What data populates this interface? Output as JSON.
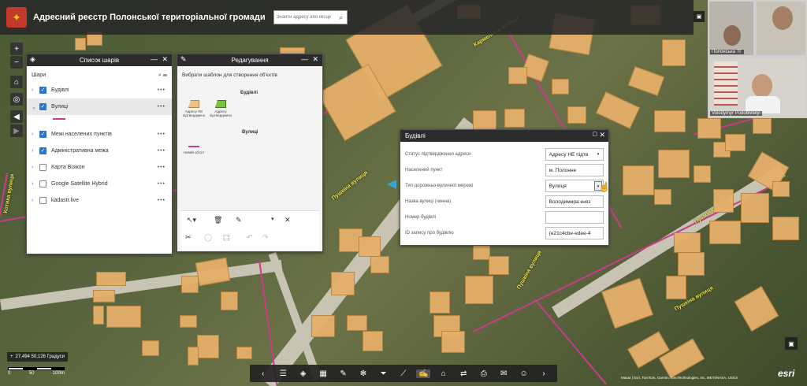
{
  "header": {
    "title": "Адресний реєстр Полонської територіальної громади",
    "search_placeholder": "Знайти адресу або місце",
    "search_icon": "search-icon"
  },
  "layer_list": {
    "title": "Список шарів",
    "section": "Шари",
    "items": [
      {
        "label": "Будівлі",
        "checked": true,
        "expanded": false
      },
      {
        "label": "Вулиці",
        "checked": true,
        "expanded": true
      },
      {
        "label": "Межі населених пунктів",
        "checked": true,
        "expanded": false
      },
      {
        "label": "Адміністративна межа",
        "checked": true,
        "expanded": false
      },
      {
        "label": "Карта Візікон",
        "checked": false,
        "expanded": false
      },
      {
        "label": "Google Satellite Hybrid",
        "checked": false,
        "expanded": false
      },
      {
        "label": "kadastr.live",
        "checked": false,
        "expanded": false
      }
    ]
  },
  "editor": {
    "title": "Редагування",
    "hint": "Вибрати шаблон для створення об'єктів",
    "group_buildings": "Будівлі",
    "group_streets": "Вулиці",
    "templates": [
      {
        "label": "Адресу НЕ підтверджено",
        "color": "#e8c48a"
      },
      {
        "label": "Адресу підтверджено",
        "color": "#7ac142"
      },
      {
        "label": "Новий об'єкт",
        "color": "#c83c8a"
      }
    ]
  },
  "attributes": {
    "title": "Будівлі",
    "rows": [
      {
        "label": "Статус підтвердження адреси",
        "value": "Адресу НЕ підтв",
        "dropdown": true
      },
      {
        "label": "Населений пункт",
        "value": "м. Полонне",
        "dropdown": false
      },
      {
        "label": "Тип дорожньо-вуличної мережі",
        "value": "Вулиця",
        "dropdown": true
      },
      {
        "label": "Назва вулиці (чинна)",
        "value": "Володимира княз",
        "dropdown": false
      },
      {
        "label": "Номер будівлі",
        "value": "",
        "dropdown": false
      },
      {
        "label": "ID запису про будівлю",
        "value": "{e21c4cbe-edee-4",
        "dropdown": false
      }
    ]
  },
  "video": {
    "participants": [
      "Полонська ТГ",
      "Volodymyr Podobivskyi"
    ]
  },
  "map": {
    "coordinates": "27,494 50,126 Градуси",
    "scale_labels": [
      "0",
      "50",
      "100m"
    ],
    "attribution": "Maxar | Esri, TomTom, Garmin, GeoTechnologies, Inc, METI/NASA, USGS",
    "esri_logo": "esri",
    "street_labels": [
      "Кармелюка вулиця",
      "Пушкіна вулиця",
      "Котика вулиця",
      "Пушкіна вулиця",
      "Пушкіна вулиця",
      "Пушкіна вулиця"
    ],
    "accent": "#c83c8a",
    "building_color": "#e6b06b"
  },
  "toolbar": {
    "icons": [
      "chevron-left-icon",
      "list-icon",
      "layers-icon",
      "grid-icon",
      "draw-icon",
      "analysis-icon",
      "filter-icon",
      "measure-icon",
      "edit-icon",
      "home-icon",
      "swipe-icon",
      "print-icon",
      "bookmark-icon",
      "info-icon",
      "chevron-right-icon"
    ],
    "active_index": 8
  }
}
